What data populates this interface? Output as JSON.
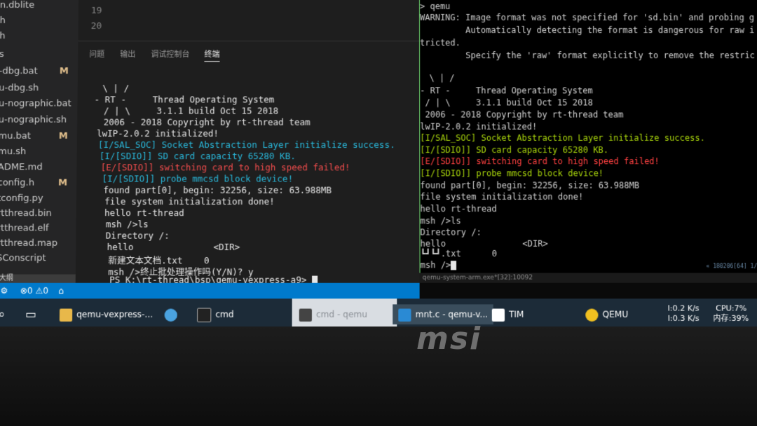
{
  "sidebar": {
    "files": [
      {
        "name": "n.dblite",
        "mark": ""
      },
      {
        "name": "h",
        "mark": ""
      },
      {
        "name": "h",
        "mark": ""
      },
      {
        "name": "s",
        "mark": ""
      },
      {
        "name": "-dbg.bat",
        "mark": "M"
      },
      {
        "name": "u-dbg.sh",
        "mark": ""
      },
      {
        "name": "u-nographic.bat",
        "mark": ""
      },
      {
        "name": "u-nographic.sh",
        "mark": ""
      },
      {
        "name": "mu.bat",
        "mark": "M"
      },
      {
        "name": "mu.sh",
        "mark": ""
      },
      {
        "name": "ADME.md",
        "mark": ""
      },
      {
        "name": "config.h",
        "mark": "M"
      },
      {
        "name": "tconfig.py",
        "mark": ""
      },
      {
        "name": "rtthread.bin",
        "mark": ""
      },
      {
        "name": "rtthread.elf",
        "mark": ""
      },
      {
        "name": "rtthread.map",
        "mark": ""
      },
      {
        "name": "SConscript",
        "mark": ""
      }
    ],
    "outline_label": "大纲"
  },
  "editor": {
    "line_numbers": [
      "19",
      "20"
    ]
  },
  "panel": {
    "tabs": [
      "问题",
      "输出",
      "调试控制台",
      "终端"
    ],
    "active_tab": "终端"
  },
  "left_terminal": {
    "lines": [
      {
        "text": " \\ | /",
        "color": "default"
      },
      {
        "text": "- RT -     Thread Operating System",
        "color": "default"
      },
      {
        "text": " / | \\     3.1.1 build Oct 15 2018",
        "color": "default"
      },
      {
        "text": " 2006 - 2018 Copyright by rt-thread team",
        "color": "default"
      },
      {
        "text": "lwIP-2.0.2 initialized!",
        "color": "default"
      },
      {
        "text": "[I/SAL_SOC] Socket Abstraction Layer initialize success.",
        "color": "cyan"
      },
      {
        "text": "[I/[SDIO]] SD card capacity 65280 KB.",
        "color": "cyan"
      },
      {
        "text": "[E/[SDIO]] switching card to high speed failed!",
        "color": "red"
      },
      {
        "text": "[I/[SDIO]] probe mmcsd block device!",
        "color": "cyan"
      },
      {
        "text": "found part[0], begin: 32256, size: 63.988MB",
        "color": "default"
      },
      {
        "text": "file system initialization done!",
        "color": "default"
      },
      {
        "text": "hello rt-thread",
        "color": "default"
      },
      {
        "text": "msh />ls",
        "color": "default"
      },
      {
        "text": "Directory /:",
        "color": "default"
      },
      {
        "text": "hello               <DIR>",
        "color": "default"
      },
      {
        "text": "新建文本文档.txt    0",
        "color": "default"
      },
      {
        "text": "msh />终止批处理操作吗(Y/N)? y",
        "color": "default"
      },
      {
        "text": "PS K:\\rt-thread\\bsp\\qemu-vexpress-a9>",
        "color": "default"
      }
    ]
  },
  "right_terminal": {
    "lines": [
      {
        "text": "> qemu",
        "color": "default"
      },
      {
        "text": "WARNING: Image format was not specified for 'sd.bin' and probing g",
        "color": "default"
      },
      {
        "text": "         Automatically detecting the format is dangerous for raw i",
        "color": "default"
      },
      {
        "text": "tricted.",
        "color": "default"
      },
      {
        "text": "         Specify the 'raw' format explicitly to remove the restric",
        "color": "default"
      },
      {
        "text": "",
        "color": "default"
      },
      {
        "text": " \\ | /",
        "color": "default"
      },
      {
        "text": "- RT -     Thread Operating System",
        "color": "default"
      },
      {
        "text": " / | \\     3.1.1 build Oct 15 2018",
        "color": "default"
      },
      {
        "text": " 2006 - 2018 Copyright by rt-thread team",
        "color": "default"
      },
      {
        "text": "lwIP-2.0.2 initialized!",
        "color": "default"
      },
      {
        "text": "[I/SAL_SOC] Socket Abstraction Layer initialize success.",
        "color": "ygreen"
      },
      {
        "text": "[I/[SDIO]] SD card capacity 65280 KB.",
        "color": "ygreen"
      },
      {
        "text": "[E/[SDIO]] switching card to high speed failed!",
        "color": "rred"
      },
      {
        "text": "[I/[SDIO]] probe mmcsd block device!",
        "color": "ygreen"
      },
      {
        "text": "found part[0], begin: 32256, size: 63.988MB",
        "color": "default"
      },
      {
        "text": "file system initialization done!",
        "color": "default"
      },
      {
        "text": "hello rt-thread",
        "color": "default"
      },
      {
        "text": "msh />ls",
        "color": "default"
      },
      {
        "text": "Directory /:",
        "color": "default"
      },
      {
        "text": "hello               <DIR>",
        "color": "default"
      },
      {
        "text": "┗┛┗┛.txt      0",
        "color": "default"
      },
      {
        "text": "msh />",
        "color": "default"
      }
    ],
    "window_title": "qemu-system-arm.exe*[32]:10092",
    "right_info": "« 180206[64] 1/1"
  },
  "statusbar": {
    "errors": "0",
    "warnings": "0",
    "info": "0"
  },
  "taskbar": {
    "items": [
      {
        "label": "qemu-vexpress-...",
        "icon": "folder-icon"
      },
      {
        "label": "",
        "icon": "chrome-icon"
      },
      {
        "label": "cmd",
        "icon": "cmd-icon"
      },
      {
        "label": "cmd - qemu",
        "icon": "cmd-icon"
      },
      {
        "label": "mnt.c - qemu-v...",
        "icon": "vscode-icon"
      },
      {
        "label": "TIM",
        "icon": "tim-icon"
      },
      {
        "label": "QEMU",
        "icon": "qemu-icon"
      }
    ],
    "net_up": "I:0.2 K/s",
    "net_down": "I:0.3 K/s",
    "cpu": "CPU:7%",
    "mem": "内存:39%"
  },
  "bezel": {
    "brand": "msi"
  }
}
